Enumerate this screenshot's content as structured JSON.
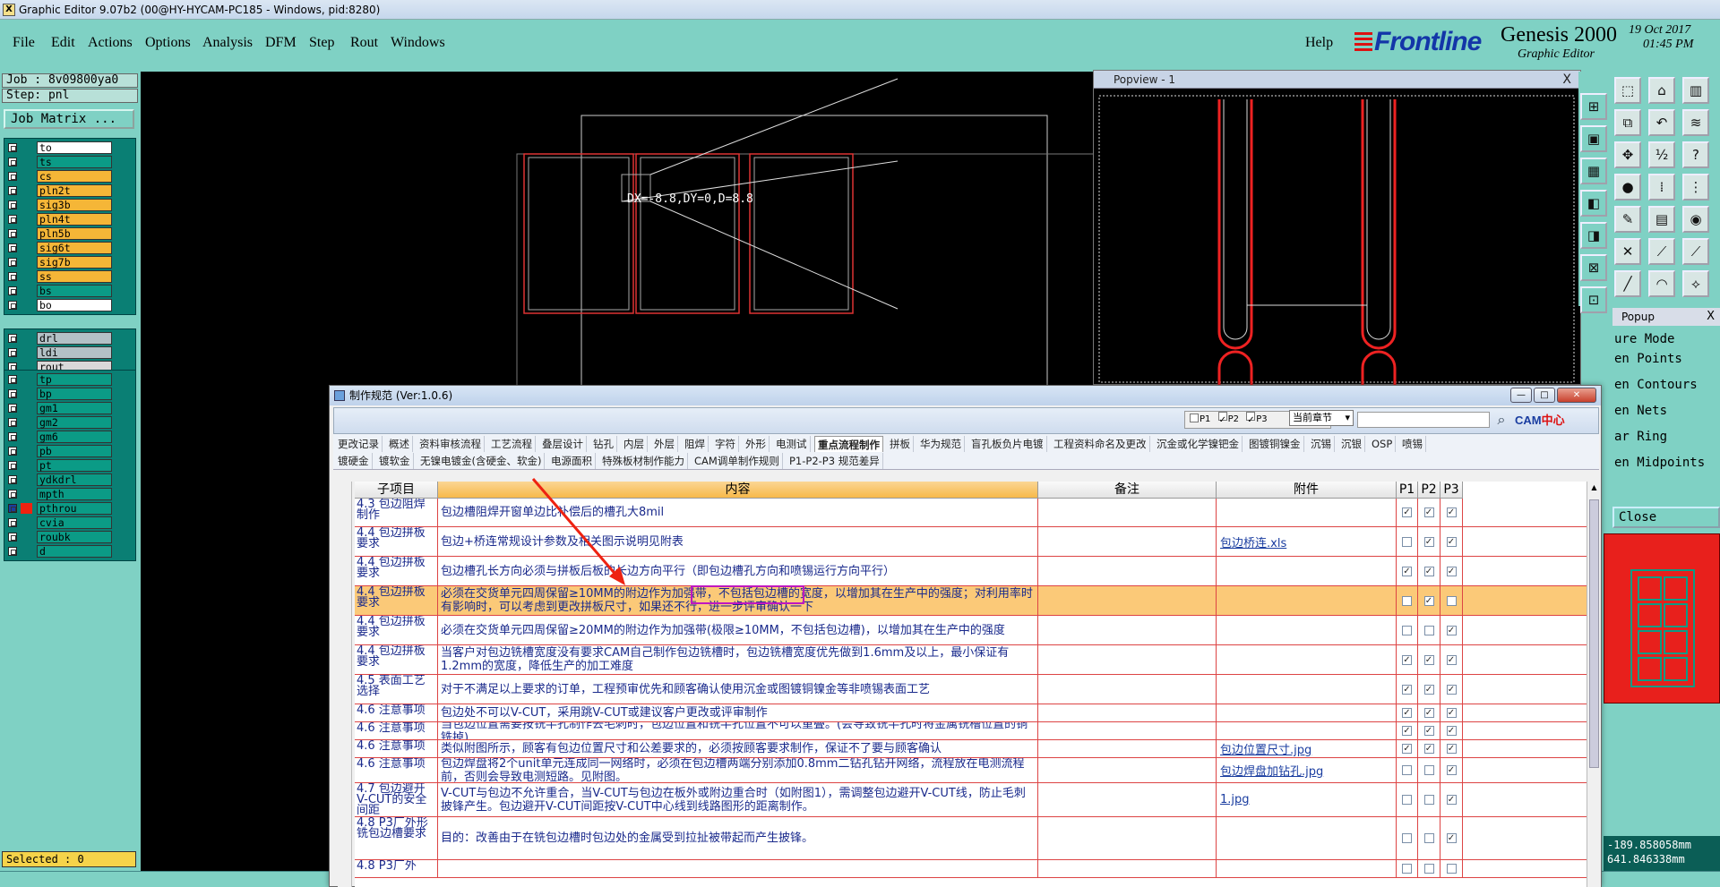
{
  "window": {
    "title": "Graphic Editor 9.07b2 (00@HY-HYCAM-PC185 - Windows, pid:8280)",
    "icon": "x-app-icon"
  },
  "menu": {
    "items": [
      "File",
      "Edit",
      "Actions",
      "Options",
      "Analysis",
      "DFM",
      "Step",
      "Rout",
      "Windows"
    ],
    "help": "Help"
  },
  "branding": {
    "frontline": "Frontline",
    "product": "Genesis 2000",
    "subtitle": "Graphic Editor",
    "date": "19 Oct 2017",
    "time": "01:45 PM"
  },
  "job": {
    "job_label": "Job : 8v09800ya0",
    "step_label": "Step: pnl",
    "job_matrix_button": "Job Matrix ...",
    "selected": "Selected : 0"
  },
  "layers": {
    "group1": [
      {
        "name": "to",
        "color": "#ffffff"
      },
      {
        "name": "ts",
        "color": "#0b9b86"
      },
      {
        "name": "cs",
        "color": "#f5b637"
      },
      {
        "name": "pln2t",
        "color": "#f5b637"
      },
      {
        "name": "sig3b",
        "color": "#f5b637"
      },
      {
        "name": "pln4t",
        "color": "#f5b637"
      },
      {
        "name": "pln5b",
        "color": "#f5b637"
      },
      {
        "name": "sig6t",
        "color": "#f5b637"
      },
      {
        "name": "sig7b",
        "color": "#f5b637"
      },
      {
        "name": "ss",
        "color": "#f5b637"
      },
      {
        "name": "bs",
        "color": "#0b9b86"
      },
      {
        "name": "bo",
        "color": "#ffffff"
      }
    ],
    "group2": [
      {
        "name": "drl",
        "color": "#b3c1c6"
      },
      {
        "name": "ldi",
        "color": "#b3c1c6"
      },
      {
        "name": "rout",
        "color": "#d9d9d9"
      }
    ],
    "group3": [
      {
        "name": "tp",
        "color": "#0b9b86"
      },
      {
        "name": "bp",
        "color": "#0b9b86"
      },
      {
        "name": "gm1",
        "color": "#0b9b86"
      },
      {
        "name": "gm2",
        "color": "#0b9b86"
      },
      {
        "name": "gm6",
        "color": "#0b9b86"
      },
      {
        "name": "pb",
        "color": "#0b9b86"
      },
      {
        "name": "pt",
        "color": "#0b9b86"
      },
      {
        "name": "ydkdrl",
        "color": "#0b9b86"
      },
      {
        "name": "mpth",
        "color": "#0b9b86"
      },
      {
        "name": "pthrou",
        "color": "#0b9b86"
      },
      {
        "name": "cvia",
        "color": "#0b9b86"
      },
      {
        "name": "roubk",
        "color": "#0b9b86"
      },
      {
        "name": "d",
        "color": "#0b9b86"
      }
    ]
  },
  "canvas": {
    "measure_text": "DX=-8.8,DY=0,D=8.8"
  },
  "popview": {
    "title": "Popview - 1",
    "close": "X"
  },
  "popup": {
    "title": "Popup",
    "close": "X",
    "items": [
      "ure Mode",
      "en Points",
      "en Contours",
      "en Nets",
      "ar Ring",
      "en Midpoints"
    ],
    "close_button": "Close"
  },
  "coords": {
    "x": "-189.858058mm",
    "y": "641.846338mm"
  },
  "dialog": {
    "title": "制作规范 (Ver:1.0.6)",
    "filter": {
      "p1": "P1",
      "p2": "P2",
      "p3": "P3",
      "chapter_select": "当前章节"
    },
    "cam_logo_a": "CAM",
    "cam_logo_b": "中心",
    "tabs_row1": [
      "更改记录",
      "概述",
      "资料审核流程",
      "工艺流程",
      "叠层设计",
      "钻孔",
      "内层",
      "外层",
      "阻焊",
      "字符",
      "外形",
      "电测试",
      "重点流程制作",
      "拼板",
      "华为规范",
      "盲孔板负片电镀",
      "工程资料命名及更改",
      "沉金或化学镍钯金",
      "图镀铜镍金",
      "沉锡",
      "沉银",
      "OSP",
      "喷锡"
    ],
    "tabs_row2": [
      "镀硬金",
      "镀软金",
      "无镍电镀金(含硬金、软金)",
      "电源面积",
      "特殊板材制作能力",
      "CAM调单制作规则",
      "P1-P2-P3 规范差异"
    ],
    "active_tab": "重点流程制作",
    "columns": {
      "section": "子项目",
      "content": "内容",
      "remark": "备注",
      "attachment": "附件",
      "p1": "P1",
      "p2": "P2",
      "p3": "P3"
    },
    "rows": [
      {
        "section": "4.3 包边阻焊制作",
        "content": "包边槽阻焊开窗单边比补偿后的槽孔大8mil",
        "remark": "",
        "attachment": "",
        "p1": true,
        "p2": true,
        "p3": true
      },
      {
        "section": "4.4 包边拼板要求",
        "content": "包边+桥连常规设计参数及相关图示说明见附表",
        "remark": "",
        "attachment": "包边桥连.xls",
        "p1": false,
        "p2": true,
        "p3": true
      },
      {
        "section": "4.4 包边拼板要求",
        "content": "包边槽孔长方向必须与拼板后板的长边方向平行（即包边槽孔方向和喷锡运行方向平行）",
        "remark": "",
        "attachment": "",
        "p1": true,
        "p2": true,
        "p3": true
      },
      {
        "section": "4.4 包边拼板要求",
        "content": "必须在交货单元四周保留≥10MM的附边作为加强带，不包括包边槽的宽度，以增加其在生产中的强度；对利用率时有影响时，可以考虑到更改拼板尺寸，如果还不行，进一步评审确认一下",
        "remark": "",
        "attachment": "",
        "p1": false,
        "p2": true,
        "p3": false
      },
      {
        "section": "4.4 包边拼板要求",
        "content": "必须在交货单元四周保留≥20MM的附边作为加强带(极限≥10MM，不包括包边槽)，以增加其在生产中的强度",
        "remark": "",
        "attachment": "",
        "p1": false,
        "p2": false,
        "p3": true
      },
      {
        "section": "4.4 包边拼板要求",
        "content": "当客户对包边铣槽宽度没有要求CAM自己制作包边铣槽时，包边铣槽宽度优先做到1.6mm及以上，最小保证有1.2mm的宽度，降低生产的加工难度",
        "remark": "",
        "attachment": "",
        "p1": true,
        "p2": true,
        "p3": true
      },
      {
        "section": "4.5 表面工艺选择",
        "content": "对于不满足以上要求的订单，工程预审优先和顾客确认使用沉金或图镀铜镍金等非喷锡表面工艺",
        "remark": "",
        "attachment": "",
        "p1": true,
        "p2": true,
        "p3": true
      },
      {
        "section": "4.6 注意事项",
        "content": "包边处不可以V-CUT，采用跳V-CUT或建议客户更改或评审制作",
        "remark": "",
        "attachment": "",
        "p1": true,
        "p2": true,
        "p3": true
      },
      {
        "section": "4.6 注意事项",
        "content": "当包边位置需要按铣半孔制作去毛刺时，包边位置和铣半孔位置不可以重叠。(会导致铣半孔时将金属铣槽位置的铜铣掉)",
        "remark": "",
        "attachment": "",
        "p1": true,
        "p2": true,
        "p3": true
      },
      {
        "section": "4.6 注意事项",
        "content": "类似附图所示，顾客有包边位置尺寸和公差要求的，必须按顾客要求制作，保证不了要与顾客确认",
        "remark": "",
        "attachment": "包边位置尺寸.jpg",
        "p1": true,
        "p2": true,
        "p3": true
      },
      {
        "section": "4.6 注意事项",
        "content": "包边焊盘将2个unit单元连成同一网络时，必须在包边槽两端分别添加0.8mm二钻孔钻开网络，流程放在电测流程前，否则会导致电测短路。见附图。",
        "remark": "",
        "attachment": "包边焊盘加钻孔.jpg",
        "p1": false,
        "p2": false,
        "p3": true
      },
      {
        "section": "4.7 包边避开V-CUT的安全间距",
        "content": "V-CUT与包边不允许重合，当V-CUT与包边在板外或附边重合时（如附图1），需调整包边避开V-CUT线，防止毛刺披锋产生。包边避开V-CUT间距按V-CUT中心线到线路图形的距离制作。",
        "remark": "",
        "attachment": "1.jpg",
        "p1": false,
        "p2": false,
        "p3": true
      },
      {
        "section": "4.8 P3厂外形铣包边槽要求",
        "content": "目的：改善由于在铣包边槽时包边处的金属受到拉扯被带起而产生披锋。",
        "remark": "",
        "attachment": "",
        "p1": false,
        "p2": false,
        "p3": true
      },
      {
        "section": "4.8 P3厂外",
        "content": "",
        "remark": "",
        "attachment": "",
        "p1": false,
        "p2": false,
        "p3": false
      }
    ]
  },
  "colors": {
    "teal_bg": "#7fd1c4",
    "canvas_bg": "#000000",
    "grid_line": "#dd4444",
    "selected_row": "#fbc978",
    "highlight_box": "#c017c0"
  }
}
